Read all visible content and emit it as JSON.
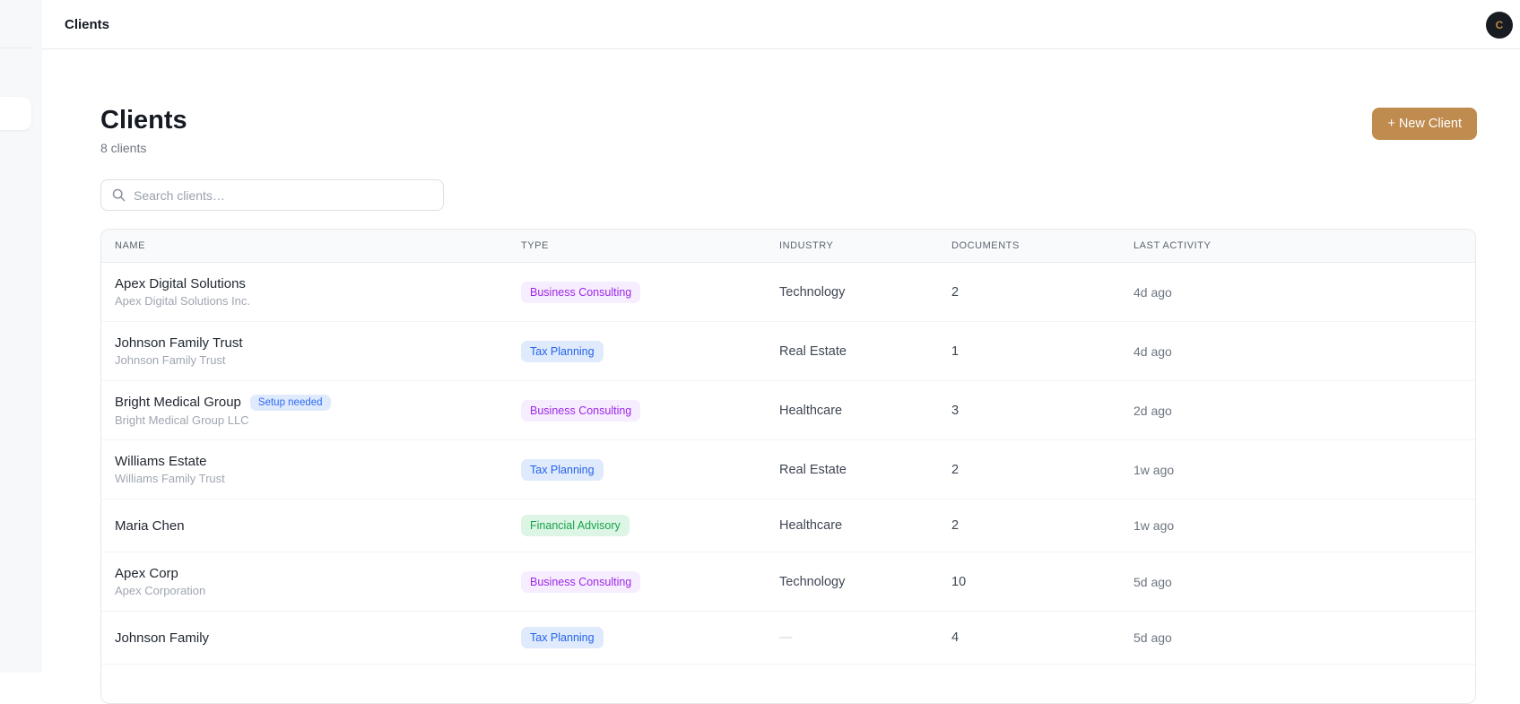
{
  "topbar": {
    "title": "Clients",
    "avatar_initial": "C"
  },
  "page": {
    "title": "Clients",
    "subtitle": "8 clients",
    "new_client_label": "+ New Client",
    "search_placeholder": "Search clients…"
  },
  "table": {
    "columns": [
      "NAME",
      "TYPE",
      "INDUSTRY",
      "DOCUMENTS",
      "LAST ACTIVITY"
    ],
    "rows": [
      {
        "name": "Apex Digital Solutions",
        "subtitle": "Apex Digital Solutions Inc.",
        "setup_badge": "",
        "type": "Business Consulting",
        "type_color": "purple",
        "industry": "Technology",
        "documents": "2",
        "last_activity": "4d ago"
      },
      {
        "name": "Johnson Family Trust",
        "subtitle": "Johnson Family Trust",
        "setup_badge": "",
        "type": "Tax Planning",
        "type_color": "blue",
        "industry": "Real Estate",
        "documents": "1",
        "last_activity": "4d ago"
      },
      {
        "name": "Bright Medical Group",
        "subtitle": "Bright Medical Group LLC",
        "setup_badge": "Setup needed",
        "type": "Business Consulting",
        "type_color": "purple",
        "industry": "Healthcare",
        "documents": "3",
        "last_activity": "2d ago"
      },
      {
        "name": "Williams Estate",
        "subtitle": "Williams Family Trust",
        "setup_badge": "",
        "type": "Tax Planning",
        "type_color": "blue",
        "industry": "Real Estate",
        "documents": "2",
        "last_activity": "1w ago"
      },
      {
        "name": "Maria Chen",
        "subtitle": "",
        "setup_badge": "",
        "type": "Financial Advisory",
        "type_color": "green",
        "industry": "Healthcare",
        "documents": "2",
        "last_activity": "1w ago"
      },
      {
        "name": "Apex Corp",
        "subtitle": "Apex Corporation",
        "setup_badge": "",
        "type": "Business Consulting",
        "type_color": "purple",
        "industry": "Technology",
        "documents": "10",
        "last_activity": "5d ago"
      },
      {
        "name": "Johnson Family",
        "subtitle": "",
        "setup_badge": "",
        "type": "Tax Planning",
        "type_color": "blue",
        "industry": "—",
        "documents": "4",
        "last_activity": "5d ago"
      }
    ]
  },
  "colors": {
    "accent_button": "#bf8b4e",
    "avatar_bg": "#181b22",
    "avatar_text": "#b9873e",
    "badge_purple_text": "#9c27e8",
    "badge_purple_bg": "#f6edfe",
    "badge_blue_text": "#2563eb",
    "badge_blue_bg": "#dfeafc",
    "badge_green_text": "#17a34a",
    "badge_green_bg": "#dcf5e4",
    "setup_badge_text": "#2e6bf2",
    "setup_badge_bg": "#dfeafc"
  }
}
